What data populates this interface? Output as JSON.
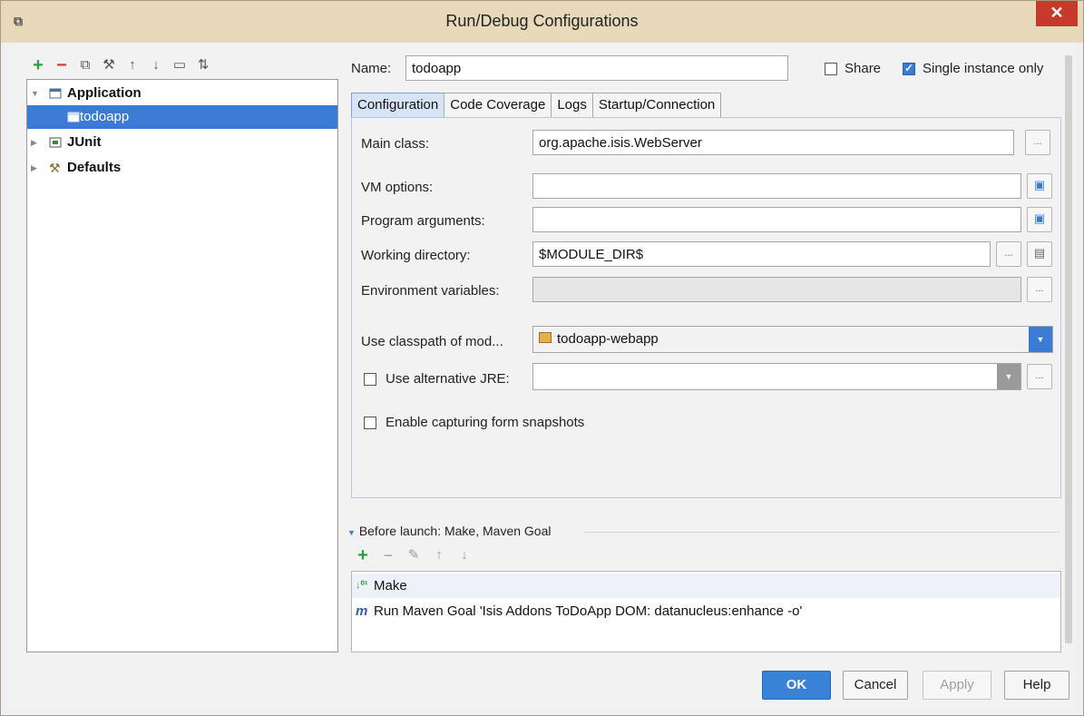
{
  "window": {
    "title": "Run/Debug Configurations",
    "close_glyph": "✕",
    "app_icon": "intellij-icon"
  },
  "toolbar": {
    "icons": [
      "add-icon",
      "remove-icon",
      "copy-icon",
      "wrench-icon",
      "move-up-icon",
      "move-down-icon",
      "folder-icon",
      "sort-icon"
    ]
  },
  "tree": {
    "items": [
      {
        "label": "Application",
        "icon": "application-icon"
      },
      {
        "label": "todoapp",
        "icon": "application-config-icon"
      },
      {
        "label": "JUnit",
        "icon": "junit-icon"
      },
      {
        "label": "Defaults",
        "icon": "wrench-icon"
      }
    ]
  },
  "name": {
    "label": "Name:",
    "value": "todoapp"
  },
  "share": {
    "label": "Share",
    "checked": false
  },
  "single_instance": {
    "label": "Single instance only",
    "checked": true
  },
  "tabs": [
    {
      "label": "Configuration",
      "active": true
    },
    {
      "label": "Code Coverage"
    },
    {
      "label": "Logs"
    },
    {
      "label": "Startup/Connection"
    }
  ],
  "form": {
    "main_class": {
      "label": "Main class:",
      "value": "org.apache.isis.WebServer"
    },
    "vm_options": {
      "label": "VM options:",
      "value": ""
    },
    "program_arguments": {
      "label": "Program arguments:",
      "value": ""
    },
    "working_directory": {
      "label": "Working directory:",
      "value": "$MODULE_DIR$"
    },
    "environment_variables": {
      "label": "Environment variables:",
      "value": ""
    },
    "classpath": {
      "label": "Use classpath of mod...",
      "value": "todoapp-webapp"
    },
    "alt_jre": {
      "label": "Use alternative JRE:",
      "checked": false,
      "value": ""
    },
    "snapshots": {
      "label": "Enable capturing form snapshots",
      "checked": false
    },
    "ellipsis": "...",
    "expand_glyph": "▣",
    "dropdown_glyph": "▼"
  },
  "before_launch": {
    "header": "Before launch: Make, Maven Goal",
    "items": [
      {
        "label": "Make",
        "icon": "make-icon"
      },
      {
        "label": "Run Maven Goal 'Isis Addons ToDoApp DOM: datanucleus:enhance -o'",
        "icon": "maven-icon"
      }
    ]
  },
  "buttons": {
    "ok": "OK",
    "cancel": "Cancel",
    "apply": "Apply",
    "help": "Help"
  },
  "colors": {
    "accent": "#3a7bd5",
    "titlebar": "#e9d9bb",
    "close": "#c7392b",
    "add": "#2e9e3e",
    "remove": "#d23b3b"
  }
}
